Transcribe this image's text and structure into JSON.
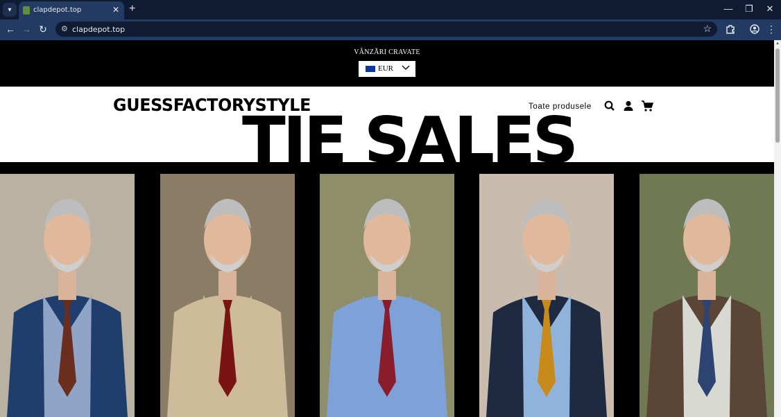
{
  "browser": {
    "tab_title": "clapdepot.top",
    "url": "clapdepot.top"
  },
  "announcement": {
    "text": "VÂNZĂRI CRAVATE"
  },
  "currency": {
    "selected": "EUR"
  },
  "header": {
    "logo": "GUESSFACTORYSTYLE",
    "nav_all_products": "Toate produsele",
    "icons": [
      "search-icon",
      "account-icon",
      "cart-icon"
    ]
  },
  "hero": {
    "banner_text": "TIE SALES"
  },
  "gallery": {
    "photos": [
      {
        "shirt": "#8fa4c6",
        "tie": "#6a2e1f",
        "jacket": "#1f3e6e",
        "bg": "#b9b2a3"
      },
      {
        "shirt": "#cdbb9a",
        "tie": "#7a1414",
        "jacket": "#cdbb9a",
        "bg": "#8a7c65"
      },
      {
        "shirt": "#7ea2d8",
        "tie": "#8a1d2b",
        "jacket": "#7ea2d8",
        "bg": "#8f8e6a"
      },
      {
        "shirt": "#8fb3db",
        "tie": "#c98a1c",
        "jacket": "#1e2a3f",
        "bg": "#c9bcae"
      },
      {
        "shirt": "#d9d9d4",
        "tie": "#2d4372",
        "jacket": "#5a4536",
        "bg": "#6f7a55"
      }
    ]
  },
  "colors": {
    "chrome_dark": "#0e1b33",
    "chrome_toolbar": "#233a63",
    "page_black": "#000000"
  }
}
